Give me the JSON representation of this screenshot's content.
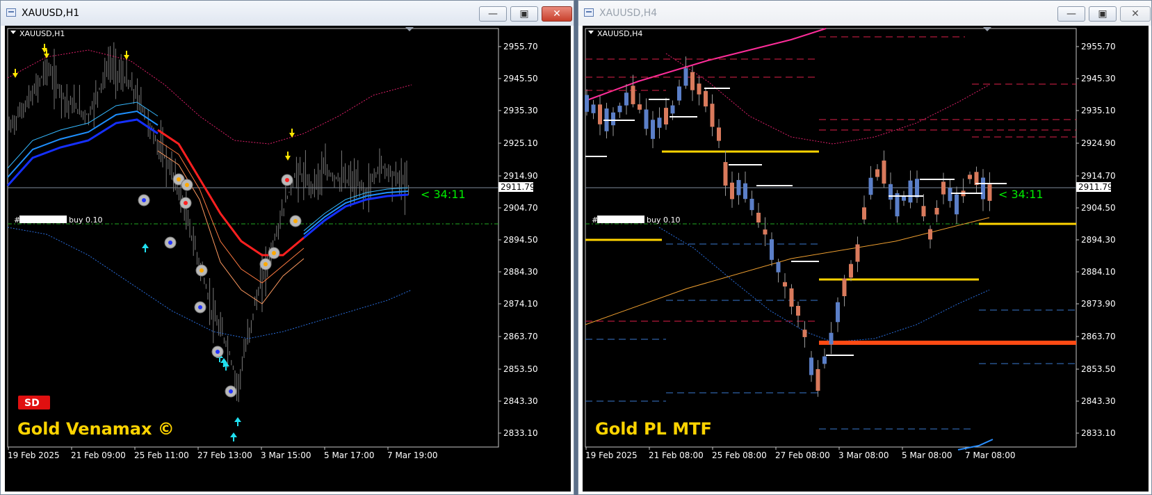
{
  "windows": [
    {
      "id": "left",
      "title": "XAUUSD,H1",
      "chart_label": "XAUUSD,H1",
      "price_labels": [
        "2955.70",
        "2945.50",
        "2935.30",
        "2925.10",
        "2914.90",
        "2904.70",
        "2894.50",
        "2884.30",
        "2874.10",
        "2863.70",
        "2853.50",
        "2843.30",
        "2833.10"
      ],
      "current_price": "2911.79",
      "countdown": "< 34:11",
      "order_label": "buy 0.10",
      "time_labels": [
        "19 Feb 2025",
        "21 Feb 09:00",
        "25 Feb 11:00",
        "27 Feb 13:00",
        "3 Mar 15:00",
        "5 Mar 17:00",
        "7 Mar 19:00"
      ],
      "badge": "SD",
      "watermark": "Gold Venamax ©"
    },
    {
      "id": "right",
      "title": "XAUUSD,H4",
      "chart_label": "XAUUSD,H4",
      "price_labels": [
        "2955.70",
        "2945.30",
        "2935.10",
        "2924.90",
        "2914.70",
        "2904.50",
        "2894.30",
        "2884.10",
        "2873.90",
        "2863.70",
        "2853.50",
        "2843.30",
        "2833.10"
      ],
      "current_price": "2911.79",
      "countdown": "< 34:11",
      "order_label": "buy 0.10",
      "time_labels": [
        "19 Feb 2025",
        "21 Feb 08:00",
        "25 Feb 08:00",
        "27 Feb 08:00",
        "3 Mar 08:00",
        "5 Mar 08:00",
        "7 Mar 08:00"
      ],
      "watermark": "Gold PL MTF"
    }
  ],
  "colors": {
    "background": "#000000",
    "candle_up": "#5b7fc8",
    "candle_down": "#d97a5c",
    "ma_blue": "#1530ff",
    "ma_red": "#ff2020",
    "countdown": "#00ee00",
    "watermark": "#ffd400",
    "order_line": "#22aa22",
    "badge": "#e01010"
  }
}
